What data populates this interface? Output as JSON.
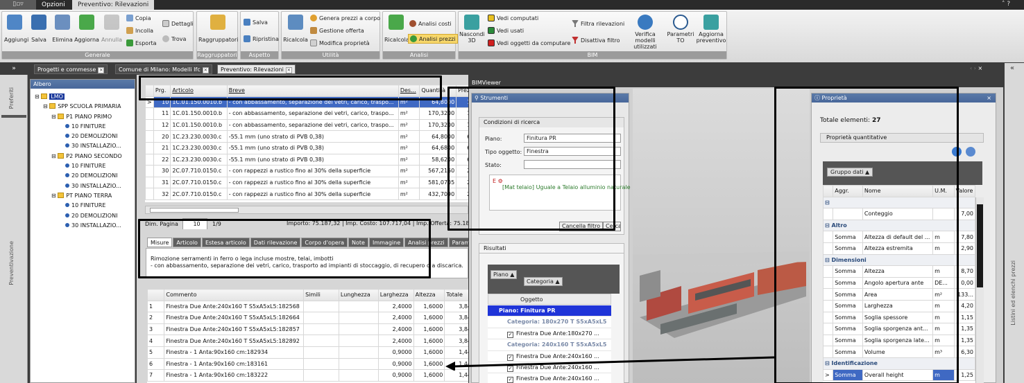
{
  "top_tabs": [
    "Opzioni",
    "Preventivo: Rilevazioni"
  ],
  "ribbon": {
    "generale": {
      "label": "Generale",
      "buttons": [
        "Aggiungi",
        "Salva",
        "Elimina",
        "Aggiorna",
        "Annulla"
      ],
      "small": [
        "Copia",
        "Incolla",
        "Esporta",
        "Dettagli",
        "Trova"
      ]
    },
    "raggruppatori": {
      "label": "Raggruppatori",
      "buttons": [
        "Raggruppatori"
      ]
    },
    "aspetto": {
      "label": "Aspetto",
      "small": [
        "Salva",
        "Ripristina"
      ]
    },
    "utilita": {
      "label": "Utilità",
      "buttons": [
        "Ricalcola"
      ],
      "small": [
        "Genera prezzi a corpo",
        "Gestione offerta",
        "Modifica proprietà"
      ]
    },
    "analisi": {
      "label": "Analisi",
      "buttons": [
        "Ricalcola"
      ],
      "small": [
        "Analisi costi",
        "Analisi prezzi"
      ]
    },
    "bim": {
      "label": "BIM",
      "buttons": [
        "Nascondi 3D",
        "Verifica modelli utilizzati",
        "Parametri TO",
        "Aggiorna preventivo"
      ],
      "small": [
        "Vedi computati",
        "Vedi usati",
        "Vedi oggetti da computare",
        "Filtra rilevazioni",
        "Disattiva filtro"
      ]
    }
  },
  "doc_tabs": [
    "Progetti e commesse",
    "Comune di Milano: Modelli Ifc",
    "Preventivo: Rilevazioni"
  ],
  "left_side": [
    "Preferiti",
    "Preventivazione"
  ],
  "right_side": "Listini ed elenchi prezzi",
  "albero": {
    "title": "Albero",
    "nodes": [
      "LMO",
      "SPP SCUOLA PRIMARIA",
      "P1 PIANO PRIMO",
      "10 FINITURE",
      "20 DEMOLIZIONI",
      "30 INSTALLAZIO...",
      "P2 PIANO SECONDO",
      "10 FINITURE",
      "20 DEMOLIZIONI",
      "30 INSTALLAZIO...",
      "PT PIANO TERRA",
      "10 FINITURE",
      "20 DEMOLIZIONI",
      "30 INSTALLAZIO..."
    ]
  },
  "main_grid": {
    "headers": [
      "Prg.",
      "Articolo",
      "Breve",
      "Des...",
      "Quantità",
      "Prezzo"
    ],
    "rows": [
      [
        "10",
        "1C.01.150.0010.b",
        "- con abbassamento, separazione dei vetri, carico, traspo...",
        "m²",
        "64,8000",
        "16,15"
      ],
      [
        "11",
        "1C.01.150.0010.b",
        "- con abbassamento, separazione dei vetri, carico, traspo...",
        "m²",
        "170,3200",
        "16,15"
      ],
      [
        "12",
        "1C.01.150.0010.b",
        "- con abbassamento, separazione dei vetri, carico, traspo...",
        "m²",
        "170,3200",
        "16,15"
      ],
      [
        "20",
        "1C.23.230.0030.c",
        "-55.1 mm (uno strato di PVB 0,38)",
        "m²",
        "64,8000",
        "60,75"
      ],
      [
        "21",
        "1C.23.230.0030.c",
        "-55.1 mm (uno strato di PVB 0,38)",
        "m²",
        "64,6800",
        "60,75"
      ],
      [
        "22",
        "1C.23.230.0030.c",
        "-55.1 mm (uno strato di PVB 0,38)",
        "m²",
        "58,6200",
        "60,75"
      ],
      [
        "30",
        "2C.07.710.0150.c",
        "- con rappezzi a rustico fino al 30% della superficie",
        "m²",
        "567,2160",
        "24,29"
      ],
      [
        "31",
        "2C.07.710.0150.c",
        "- con rappezzi a rustico fino al 30% della superficie",
        "m²",
        "581,0705",
        "24,29"
      ],
      [
        "32",
        "2C.07.710.0150.c",
        "- con rappezzi a rustico fino al 30% della superficie",
        "m²",
        "432,7090",
        "24,29"
      ]
    ]
  },
  "pager": {
    "dim_label": "Dim. Pagina",
    "dim_value": "10",
    "page": "1/9",
    "totals": "Importo: 75.187,32 | Imp. Costo: 107.717,04 | Imp. Offerta: 75.18"
  },
  "detail_tabs": [
    "Misure",
    "Articolo",
    "Estesa articolo",
    "Dati rilevazione",
    "Corpo d'opera",
    "Note",
    "Immagine",
    "Analisi prezzi",
    "Parametri"
  ],
  "description": [
    "Rimozione serramenti in ferro o lega incluse mostre, telai, imbotti",
    "- con abbassamento, separazione dei vetri, carico, trasporto ad impianti di stoccaggio, di recupero o a discarica."
  ],
  "misure": {
    "headers": [
      "",
      "Commento",
      "Simili",
      "Lunghezza",
      "Larghezza",
      "Altezza",
      "Totale"
    ],
    "rows": [
      [
        "1",
        "Finestra Due Ante:240x160 T S5xA5xL5:182568",
        "",
        "",
        "2,4000",
        "1,6000",
        "3,84"
      ],
      [
        "2",
        "Finestra Due Ante:240x160 T S5xA5xL5:182664",
        "",
        "",
        "2,4000",
        "1,6000",
        "3,84"
      ],
      [
        "3",
        "Finestra Due Ante:240x160 T S5xA5xL5:182857",
        "",
        "",
        "2,4000",
        "1,6000",
        "3,84"
      ],
      [
        "4",
        "Finestra Due Ante:240x160 T S5xA5xL5:182892",
        "",
        "",
        "2,4000",
        "1,6000",
        "3,84"
      ],
      [
        "5",
        "Finestra - 1 Anta:90x160 cm:182934",
        "",
        "",
        "0,9000",
        "1,6000",
        "1,44"
      ],
      [
        "6",
        "Finestra - 1 Anta:90x160 cm:183161",
        "",
        "",
        "0,9000",
        "1,6000",
        "1,44"
      ],
      [
        "7",
        "Finestra - 1 Anta:90x160 cm:183222",
        "",
        "",
        "0,9000",
        "1,6000",
        "1,44"
      ]
    ]
  },
  "bimviewer": {
    "title": "BIMViewer"
  },
  "strumenti": {
    "title": "Strumenti",
    "cond_title": "Condizioni di ricerca",
    "piano_label": "Piano:",
    "piano_value": "Finitura PR",
    "tipo_label": "Tipo oggetto:",
    "tipo_value": "Finestra",
    "stato_label": "Stato:",
    "rule": "[Mat telaio] Uguale a Telaio alluminio naturale",
    "cancel_btn": "Cancella filtro",
    "search_btn": "Cerca",
    "risultati": "Risultati",
    "group_chips": [
      "Piano",
      "Categoria"
    ],
    "col_oggetto": "Oggetto",
    "results": [
      "Piano: Finitura PR",
      "Categoria: 180x270 T S5xA5xL5",
      "Finestra Due Ante:180x270 ...",
      "Categoria: 240x160 T S5xA5xL5",
      "Finestra Due Ante:240x160 ...",
      "Finestra Due Ante:240x160 ...",
      "Finestra Due Ante:240x160 ..."
    ]
  },
  "proprieta": {
    "title": "Proprietà",
    "totale_label": "Totale elementi:",
    "totale_value": "27",
    "section": "Proprietà quantitative",
    "gruppo_chip": "Gruppo dati",
    "headers": [
      "Aggr.",
      "Nome",
      "U.M.",
      "Valore"
    ],
    "rows": [
      {
        "cat": ""
      },
      {
        "a": "",
        "n": "Conteggio",
        "u": "",
        "v": "7,00"
      },
      {
        "cat": "Altro"
      },
      {
        "a": "Somma",
        "n": "Altezza di default del ...",
        "u": "m",
        "v": "7,80"
      },
      {
        "a": "Somma",
        "n": "Altezza estremita",
        "u": "m",
        "v": "2,90"
      },
      {
        "cat": "Dimensioni"
      },
      {
        "a": "Somma",
        "n": "Altezza",
        "u": "m",
        "v": "8,70"
      },
      {
        "a": "Somma",
        "n": "Angolo apertura ante",
        "u": "DE...",
        "v": "0,00"
      },
      {
        "a": "Somma",
        "n": "Area",
        "u": "m²",
        "v": "133..."
      },
      {
        "a": "Somma",
        "n": "Larghezza",
        "u": "m",
        "v": "4,20"
      },
      {
        "a": "Somma",
        "n": "Soglia spessore",
        "u": "m",
        "v": "1,15"
      },
      {
        "a": "Somma",
        "n": "Soglia sporgenza ant...",
        "u": "m",
        "v": "1,35"
      },
      {
        "a": "Somma",
        "n": "Soglia sporgenza late...",
        "u": "m",
        "v": "1,35"
      },
      {
        "a": "Somma",
        "n": "Volume",
        "u": "m³",
        "v": "6,30"
      },
      {
        "cat": "Identificazione"
      },
      {
        "a": "Somma",
        "n": "Overall height",
        "u": "m",
        "v": "1,25",
        "sel": true
      }
    ]
  }
}
